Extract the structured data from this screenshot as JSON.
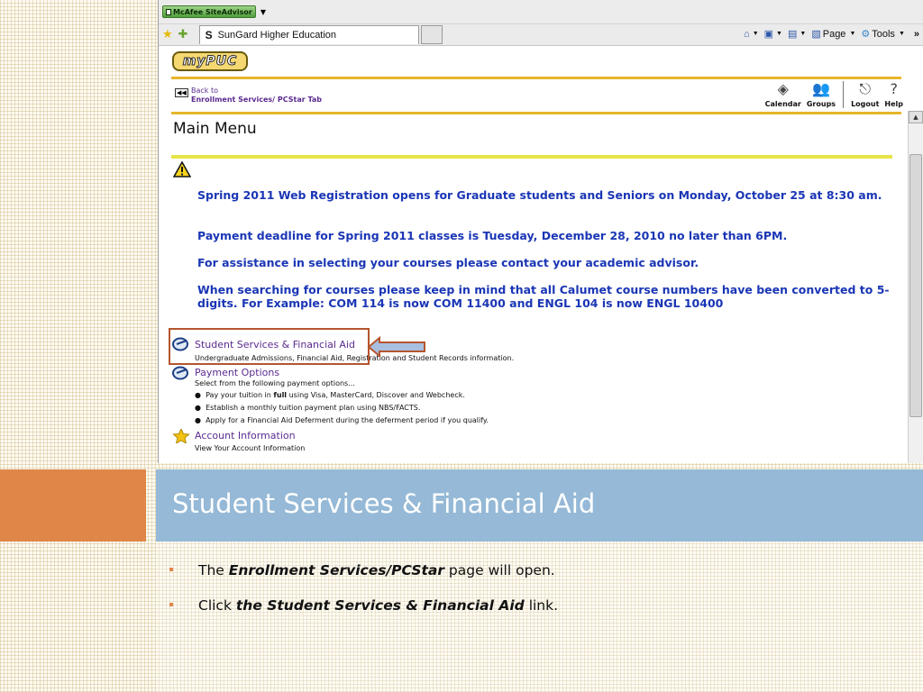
{
  "browser": {
    "toolbar_extension": "McAfee SiteAdvisor",
    "tab_title": "SunGard Higher Education",
    "tab_icon": "S",
    "command_bar": {
      "page_label": "Page",
      "tools_label": "Tools",
      "more": "»"
    }
  },
  "app": {
    "logo": "myPUC",
    "back": {
      "line1": "Back to",
      "line2": "Enrollment Services/ PCStar Tab"
    },
    "nav": [
      {
        "label": "Calendar",
        "icon": "calendar-icon"
      },
      {
        "label": "Groups",
        "icon": "groups-icon"
      },
      {
        "label": "Logout",
        "icon": "logout-icon"
      },
      {
        "label": "Help",
        "icon": "help-icon"
      }
    ],
    "page_title": "Main Menu",
    "notices": [
      "Spring 2011 Web Registration opens for Graduate students and Seniors on Monday, October 25 at 8:30 am.",
      "Payment deadline for Spring 2011 classes is Tuesday, December 28, 2010 no later than 6PM.",
      "For assistance in selecting your courses please contact your academic advisor.",
      "When searching for courses please keep in mind that all Calumet course numbers have been converted to 5-digits. For Example: COM 114 is now COM 11400 and ENGL 104 is now ENGL 10400"
    ],
    "menu": {
      "student_services": {
        "title": "Student Services & Financial Aid",
        "desc": "Undergraduate Admissions, Financial Aid, Registration and Student Records information."
      },
      "payment_options": {
        "title": "Payment Options",
        "desc": "Select from the following payment options...",
        "bullets": [
          {
            "pre": "Pay your tuition in ",
            "bold": "full",
            "post": " using Visa, MasterCard, Discover and Webcheck."
          },
          {
            "pre": "Establish a monthly tuition payment plan using NBS/FACTS.",
            "bold": "",
            "post": ""
          },
          {
            "pre": "Apply for a Financial Aid Deferment during the deferment period if you qualify.",
            "bold": "",
            "post": ""
          }
        ]
      },
      "account_information": {
        "title": "Account Information",
        "desc": "View Your Account Information"
      }
    },
    "colors": {
      "link_purple": "#5b2b90",
      "notice_blue": "#1a36b5",
      "accent_gold": "#e8b52a",
      "highlight_ring": "#b5552e"
    }
  },
  "slide": {
    "title": "Student Services & Financial Aid",
    "bullets": [
      {
        "pre": "The ",
        "em": "Enrollment Services/PCStar",
        "post": " page will open."
      },
      {
        "pre": "Click ",
        "em": "the Student Services & Financial Aid",
        "post": " link."
      }
    ],
    "colors": {
      "orange_band": "#df8649",
      "blue_band": "#95b9d6"
    }
  }
}
